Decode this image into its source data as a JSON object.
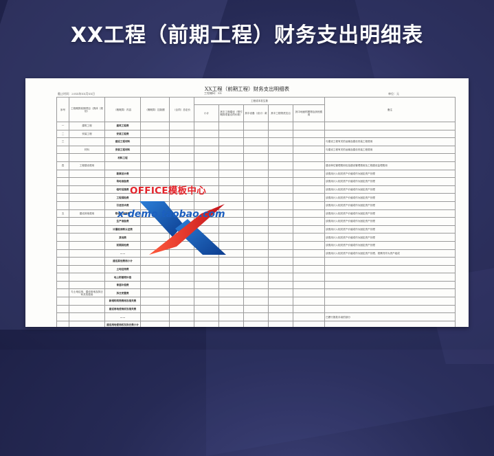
{
  "banner": {
    "title": "XX工程（前期工程）财务支出明细表"
  },
  "document": {
    "title": "XX工程（前期工程）财务支出明细表",
    "date": "截止时间：20XX年XX月XX日",
    "project": "工程编码：XX",
    "unit": "单位：元"
  },
  "table": {
    "headers": {
      "seq": "序号",
      "project_name": "工程概算前期项目（具体（规划）",
      "budget_content": "（概概算）内容",
      "budget_amount": "（概概算）控制额",
      "contract_total": "（合同）总定价",
      "cost_total": "工程成本发生数",
      "subtotal": "小计",
      "sub1": "其中工程建设（预付概算或者合同价款）",
      "sub2": "其中设备（设计）款",
      "sub3": "其中工程物资支出",
      "sub4": "其中地面附着物及其他费用",
      "remarks": "备注"
    },
    "rows": [
      {
        "seq": "一",
        "group": "建筑工程",
        "item": "建筑工程费",
        "remark": ""
      },
      {
        "seq": "二",
        "group": "安装工程",
        "item": "安装工程费",
        "remark": ""
      },
      {
        "seq": "三",
        "group": "",
        "item": "建设工程材料",
        "remark": "与建设工程有关的运输及建设安装工程费用"
      },
      {
        "seq": "",
        "group": "材料",
        "item": "安装工程材料",
        "remark": "与建设工程有关的运输及建设安装工程费用"
      },
      {
        "seq": "",
        "group": "",
        "item": "材料工程",
        "remark": ""
      },
      {
        "seq": "四",
        "group": "工程建设费用",
        "item": "",
        "remark": "建设单位管理费用包括建设管理费用及工程建设监理费用"
      },
      {
        "seq": "",
        "group": "",
        "item": "勘察设计费",
        "remark": "该费用计入相关资产价值或作为固定资产处理"
      },
      {
        "seq": "",
        "group": "",
        "item": "场地准备费",
        "remark": "该费用计入相关资产价值或作为固定资产处理"
      },
      {
        "seq": "",
        "group": "",
        "item": "临时设施费",
        "remark": "该费用计入相关资产价值或作为固定资产处理"
      },
      {
        "seq": "",
        "group": "",
        "item": "工程保险费",
        "remark": "该费用计入相关资产价值或作为固定资产处理"
      },
      {
        "seq": "",
        "group": "",
        "item": "引进技术费",
        "remark": "该费用计入相关资产价值或作为固定资产处理"
      },
      {
        "seq": "五",
        "group": "建设其他费用",
        "item": "联合试运转费",
        "remark": "该费用计入相关资产价值或作为固定资产处理"
      },
      {
        "seq": "",
        "group": "",
        "item": "生产准备费",
        "remark": "该费用计入相关资产价值或作为固定资产处理"
      },
      {
        "seq": "",
        "group": "",
        "item": "计量检测和认证费",
        "remark": "该费用计入相关资产价值或作为固定资产处理"
      },
      {
        "seq": "",
        "group": "",
        "item": "其他费",
        "remark": "该费用计入相关资产价值或作为固定资产处理"
      },
      {
        "seq": "",
        "group": "",
        "item": "前期其他费",
        "remark": "该费用计入相关资产价值或作为固定资产处理"
      },
      {
        "seq": "",
        "group": "",
        "item": "……",
        "remark": "该费用计入相关资产价值或作为固定资产处理，视情况作为资产组成"
      },
      {
        "seq": "",
        "group": "",
        "item": "建设其他费用小计",
        "remark": ""
      },
      {
        "seq": "",
        "group": "",
        "item": "土地征用费",
        "remark": ""
      },
      {
        "seq": "",
        "group": "",
        "item": "地上附着物补偿",
        "remark": ""
      },
      {
        "seq": "",
        "group": "",
        "item": "青苗补偿费",
        "remark": ""
      },
      {
        "seq": "",
        "group": "与土地征用、建设用地及拆迁有关的费用",
        "item": "拆迁安置费",
        "remark": ""
      },
      {
        "seq": "",
        "group": "",
        "item": "新增构筑物费用及相关费",
        "remark": ""
      },
      {
        "seq": "",
        "group": "",
        "item": "建设用地使用权及相关费",
        "remark": ""
      },
      {
        "seq": "",
        "group": "",
        "item": "……",
        "remark": "已履行报批手续的部分"
      },
      {
        "seq": "",
        "group": "",
        "item": "建设用地使用权及拆迁费小计",
        "remark": ""
      }
    ]
  },
  "watermark": {
    "brand": "OFFICE模板中心",
    "url": "x-demo.taobao.com"
  }
}
